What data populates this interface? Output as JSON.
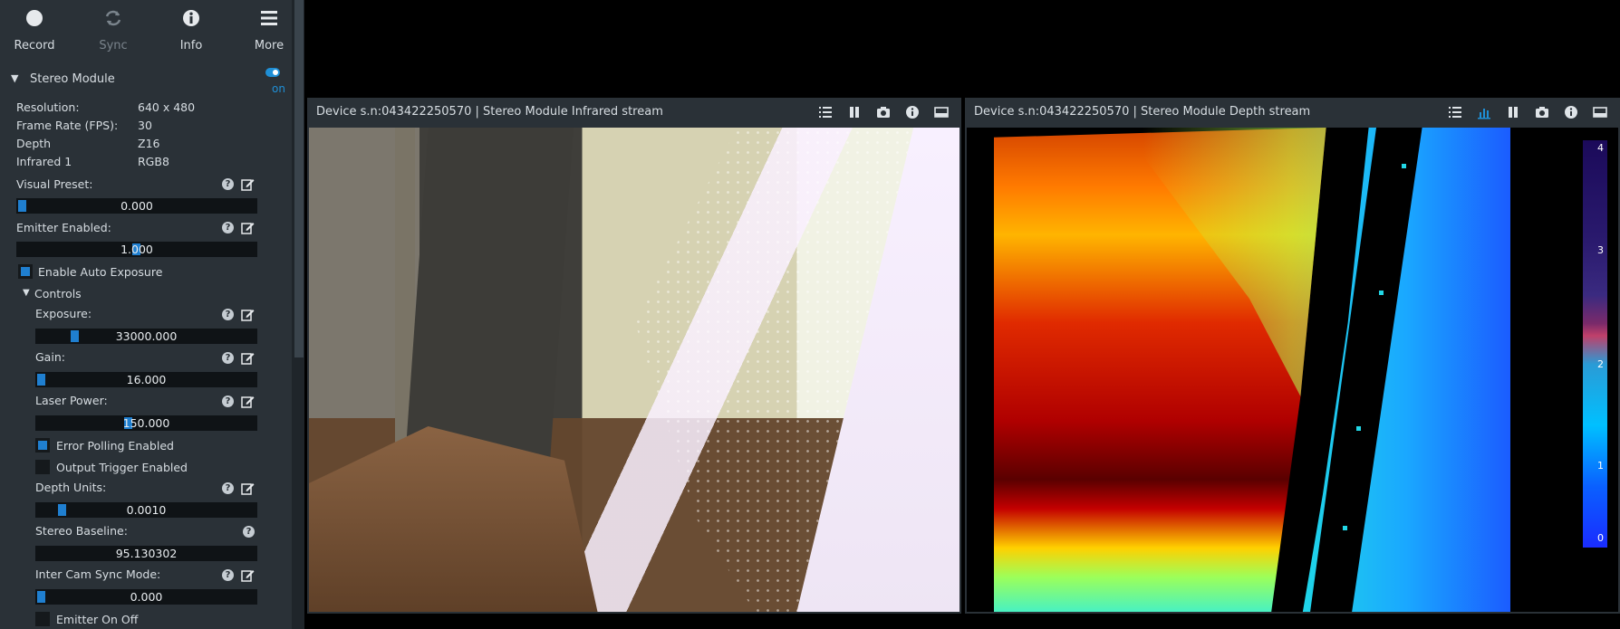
{
  "toolbar": {
    "record_label": "Record",
    "sync_label": "Sync",
    "info_label": "Info",
    "more_label": "More"
  },
  "module": {
    "title": "Stereo Module",
    "toggle_label": "on",
    "resolution_label": "Resolution:",
    "resolution_value": "640 x 480",
    "fps_label": "Frame Rate (FPS):",
    "fps_value": "30",
    "depth_label": "Depth",
    "depth_value": "Z16",
    "infrared_label": "Infrared 1",
    "infrared_value": "RGB8"
  },
  "options": {
    "visual_preset_label": "Visual Preset:",
    "visual_preset_value": "0.000",
    "emitter_enabled_label": "Emitter Enabled:",
    "emitter_enabled_value": "1.000",
    "auto_exposure_label": "Enable Auto Exposure",
    "controls_label": "Controls",
    "exposure_label": "Exposure:",
    "exposure_value": "33000.000",
    "gain_label": "Gain:",
    "gain_value": "16.000",
    "laser_power_label": "Laser Power:",
    "laser_power_value": "150.000",
    "error_polling_label": "Error Polling Enabled",
    "output_trigger_label": "Output Trigger Enabled",
    "depth_units_label": "Depth Units:",
    "depth_units_value": "0.0010",
    "stereo_baseline_label": "Stereo Baseline:",
    "stereo_baseline_value": "95.130302",
    "inter_cam_sync_label": "Inter Cam Sync Mode:",
    "inter_cam_sync_value": "0.000",
    "emitter_on_off_label": "Emitter On Off"
  },
  "streams": {
    "infrared_title": "Device s.n:043422250570 | Stereo Module Infrared stream",
    "depth_title": "Device s.n:043422250570 | Stereo Module Depth stream",
    "colorbar_ticks": [
      "4",
      "3",
      "2",
      "1",
      "0"
    ]
  },
  "colors": {
    "accent": "#1f8fd6",
    "panel_bg": "#2a3137",
    "slider_bg": "#0f1316"
  }
}
